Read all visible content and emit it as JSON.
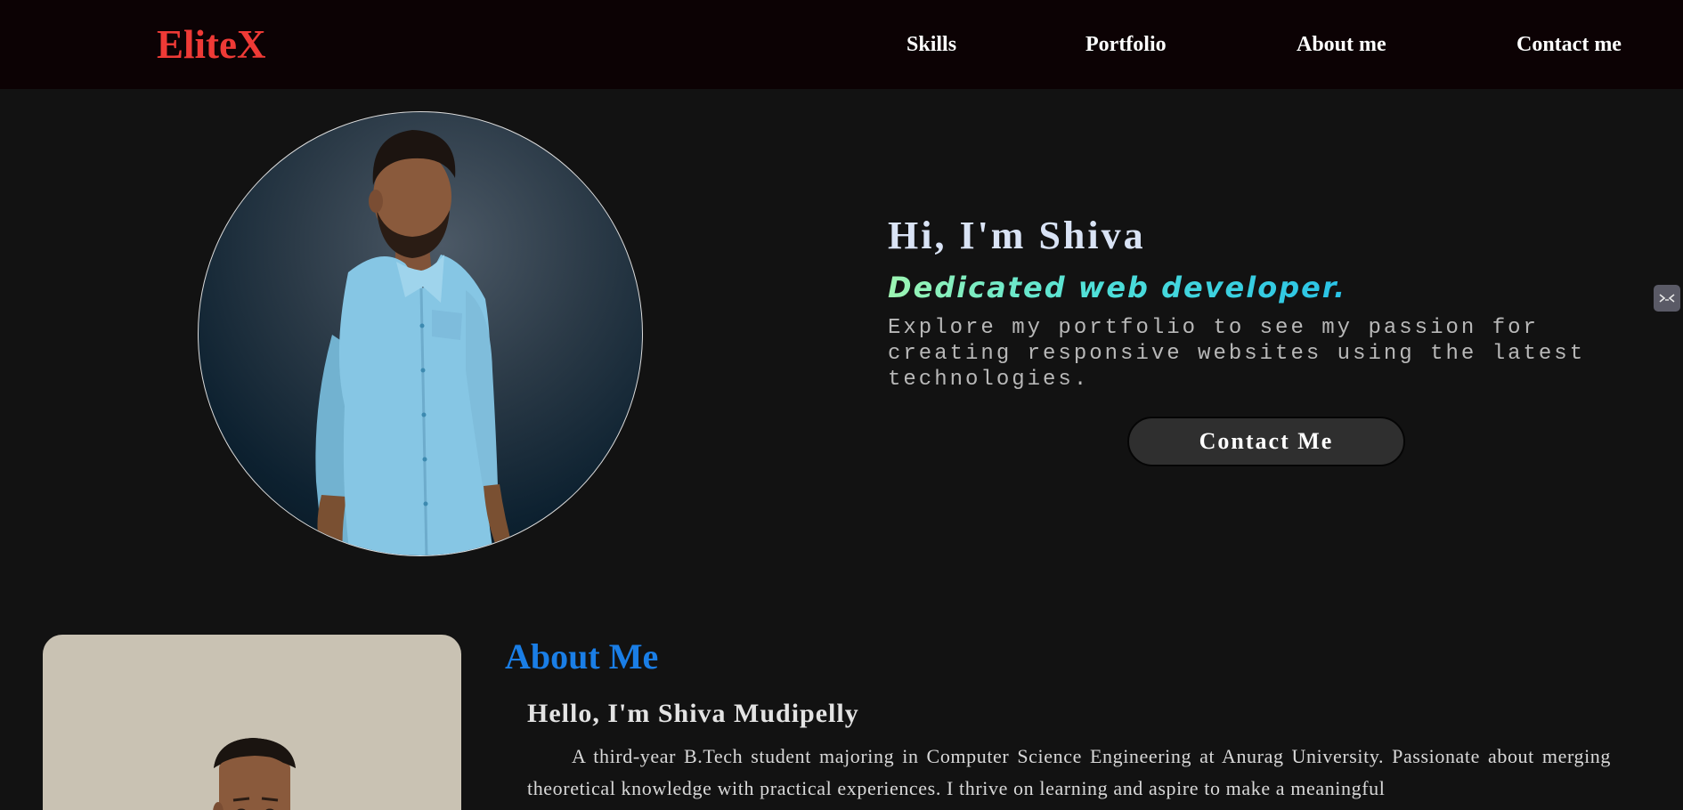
{
  "header": {
    "logo": "EliteX",
    "nav": [
      {
        "label": "Skills"
      },
      {
        "label": "Portfolio"
      },
      {
        "label": "About me"
      },
      {
        "label": "Contact me"
      }
    ]
  },
  "hero": {
    "title": "Hi, I'm Shiva",
    "subtitle": "Dedicated web developer.",
    "description": "Explore my portfolio to see my passion for creating responsive websites using the latest technologies.",
    "button_label": "Contact Me",
    "photo_icon": "person-photo"
  },
  "side_widget": {
    "icon": "collapse-icon"
  },
  "about": {
    "heading": "About Me",
    "name": "Hello, I'm Shiva Mudipelly",
    "body": "A third-year B.Tech student majoring in Computer Science Engineering at Anurag University. Passionate about merging theoretical knowledge with practical experiences. I thrive on learning and aspire to make a meaningful",
    "photo_icon": "person-photo"
  },
  "colors": {
    "header_bg": "#0c0204",
    "page_bg": "#121212",
    "logo": "#ee3a36",
    "accent_blue": "#1a7ee6",
    "subtitle_gradient_start": "#9df5b2",
    "subtitle_gradient_end": "#29c2e6",
    "button_bg": "#2f2f2f"
  }
}
